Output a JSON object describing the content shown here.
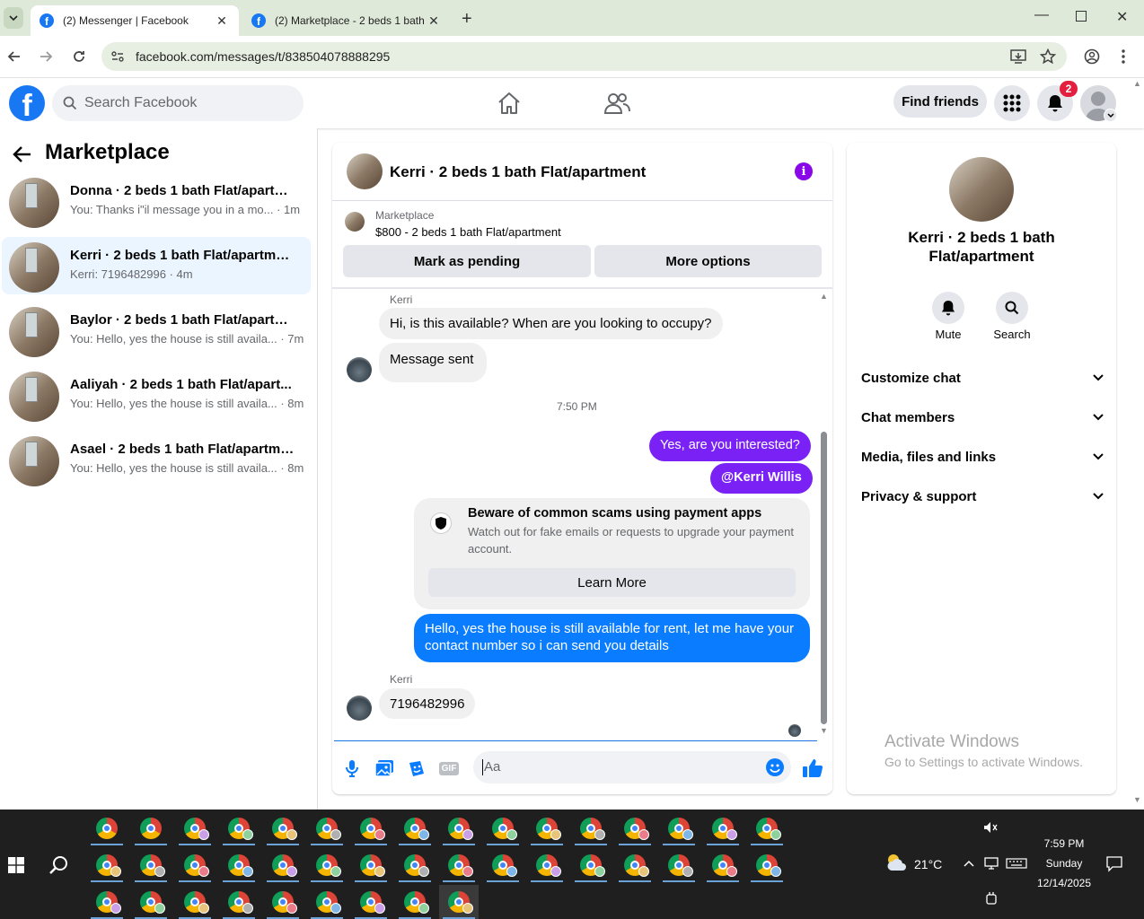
{
  "browser": {
    "tabs": [
      {
        "title": "(2) Messenger | Facebook",
        "active": true
      },
      {
        "title": "(2) Marketplace - 2 beds 1 bath",
        "active": false
      }
    ],
    "url": "facebook.com/messages/t/838504078888295"
  },
  "facebook": {
    "logo": "f",
    "search_placeholder": "Search Facebook",
    "find_friends": "Find friends",
    "notification_count": "2"
  },
  "left": {
    "title": "Marketplace",
    "conversations": [
      {
        "name": "Donna · 2 beds 1 bath Flat/apartm...",
        "preview": "You: Thanks i\"il message you in a mo... · 1m",
        "selected": false
      },
      {
        "name": "Kerri · 2 beds 1 bath Flat/apartment",
        "preview": "Kerri: 7196482996 · 4m",
        "selected": true
      },
      {
        "name": "Baylor · 2 beds 1 bath Flat/apartm...",
        "preview": "You: Hello, yes the house is still availa... · 7m",
        "selected": false
      },
      {
        "name": "Aaliyah · 2 beds 1 bath Flat/apart...",
        "preview": "You: Hello, yes the house is still availa... · 8m",
        "selected": false
      },
      {
        "name": "Asael · 2 beds 1 bath Flat/apartment",
        "preview": "You: Hello, yes the house is still availa... · 8m",
        "selected": false
      }
    ]
  },
  "chat": {
    "title": "Kerri · 2 beds 1 bath Flat/apartment",
    "listing_source": "Marketplace",
    "listing": "$800 - 2 beds 1 bath Flat/apartment",
    "mark_pending": "Mark as pending",
    "more_options": "More options",
    "sender1": "Kerri",
    "msg1": "Hi, is this available? When are you looking to occupy?",
    "msg2": "Message sent",
    "time": "7:50 PM",
    "msg3": "Yes, are you interested?",
    "msg4": "@Kerri Willis",
    "scam_title": "Beware of common scams using payment apps",
    "scam_body": "Watch out for fake emails or requests to upgrade your payment account.",
    "learn_more": "Learn More",
    "msg5": "Hello, yes the house is still available for rent, let me have your contact number so i can send you details",
    "sender2": "Kerri",
    "msg6": "7196482996",
    "composer_placeholder": "Aa",
    "gif": "GIF"
  },
  "right": {
    "name": "Kerri · 2 beds 1 bath Flat/apartment",
    "mute": "Mute",
    "search": "Search",
    "sections": [
      "Customize chat",
      "Chat members",
      "Media, files and links",
      "Privacy & support"
    ],
    "watermark_title": "Activate Windows",
    "watermark_body": "Go to Settings to activate Windows."
  },
  "taskbar": {
    "weather": "21°C",
    "time": "7:59 PM",
    "day": "Sunday",
    "date": "12/14/2025"
  },
  "colors": {
    "fb_blue": "#1877f2",
    "outgoing": "#0a7cff",
    "purple": "#7a22f5"
  }
}
